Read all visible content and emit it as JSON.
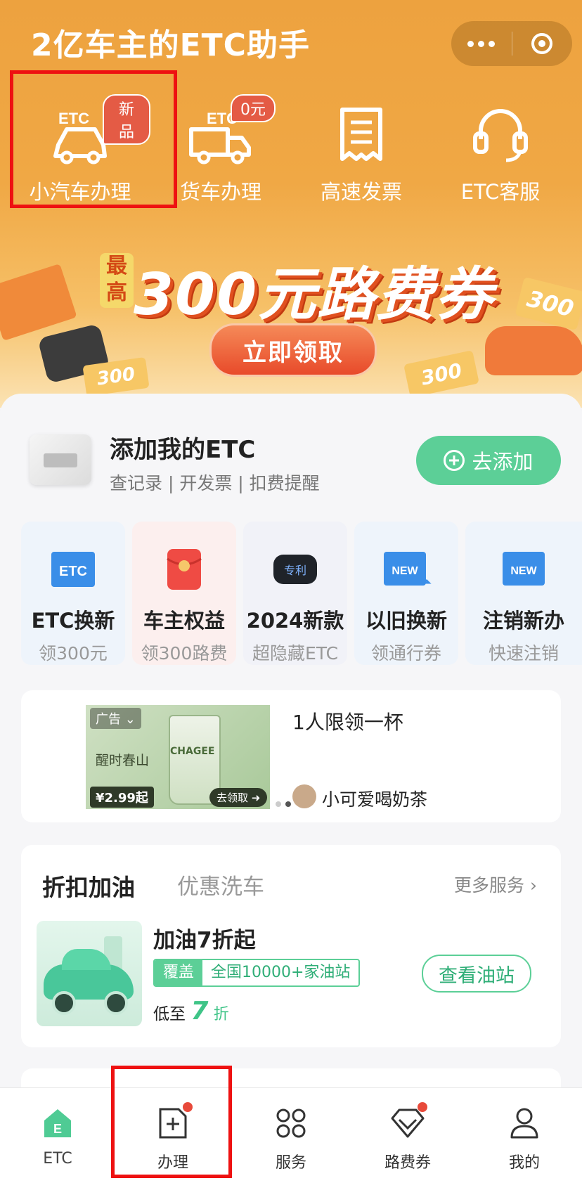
{
  "header": {
    "title": "2亿车主的ETC助手"
  },
  "quick_entries": [
    {
      "label": "小汽车办理",
      "badge": "新品",
      "icon": "car-etc-icon"
    },
    {
      "label": "货车办理",
      "badge": "0元",
      "icon": "truck-etc-icon"
    },
    {
      "label": "高速发票",
      "badge": "",
      "icon": "receipt-icon"
    },
    {
      "label": "ETC客服",
      "badge": "",
      "icon": "headset-icon"
    }
  ],
  "banner": {
    "prefix": "最高",
    "headline": "300元路费券",
    "button": "立即领取",
    "coupon_value": "300"
  },
  "add_etc": {
    "title": "添加我的ETC",
    "subtitle": "查记录 | 开发票 | 扣费提醒",
    "button": "去添加"
  },
  "services": [
    {
      "title": "ETC换新",
      "sub": "领300元",
      "icon": "etc-card-icon",
      "icon_text": "ETC"
    },
    {
      "title": "车主权益",
      "sub": "领300路费",
      "icon": "red-envelope-icon",
      "icon_text": ""
    },
    {
      "title": "2024新款",
      "sub": "超隐藏ETC",
      "icon": "etc-device-icon",
      "icon_text": "专利"
    },
    {
      "title": "以旧换新",
      "sub": "领通行券",
      "icon": "new-swap-icon",
      "icon_text": "NEW"
    },
    {
      "title": "注销新办",
      "sub": "快速注销",
      "icon": "new-cancel-icon",
      "icon_text": "NEW"
    }
  ],
  "ad": {
    "tag": "广告",
    "image_slogan": "醒时春山",
    "image_brand": "CHAGEE",
    "image_price": "¥2.99起",
    "image_button": "去领取",
    "title": "1人限领一杯",
    "author": "小可爱喝奶茶"
  },
  "fuel": {
    "tabs": [
      "折扣加油",
      "优惠洗车"
    ],
    "more": "更多服务 ›",
    "title": "加油7折起",
    "badge_label": "覆盖",
    "badge_value": "全国10000+家油站",
    "discount_prefix": "低至",
    "discount_value": "7",
    "discount_unit": "折",
    "button": "查看油站"
  },
  "tabbar": [
    {
      "label": "ETC",
      "icon": "etc-home-icon",
      "dot": false
    },
    {
      "label": "办理",
      "icon": "apply-doc-icon",
      "dot": true
    },
    {
      "label": "服务",
      "icon": "grid-services-icon",
      "dot": false
    },
    {
      "label": "路费券",
      "icon": "coupon-diamond-icon",
      "dot": true
    },
    {
      "label": "我的",
      "icon": "user-icon",
      "dot": false
    }
  ],
  "colors": {
    "header_orange": "#eda23f",
    "accent_green": "#5ccf97",
    "highlight_red": "#e11111",
    "badge_red": "#e45b45"
  }
}
